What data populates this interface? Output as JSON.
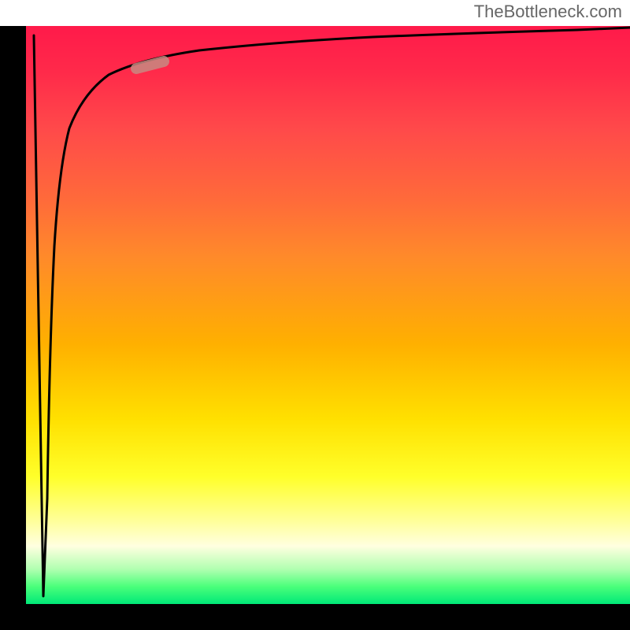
{
  "attribution": "TheBottleneck.com",
  "chart_data": {
    "type": "line",
    "title": "",
    "xlabel": "",
    "ylabel": "",
    "xlim": [
      0,
      100
    ],
    "ylim": [
      0,
      100
    ],
    "note": "Axes are unlabeled black bars; values normalized 0-100 on each axis. Background is a vertical red→orange→yellow→green gradient (red = high bottleneck, green = low). Curve is a single black line with a sharp initial spike from top to bottom and an asymptotic rise to the right. A salmon-colored pill marker highlights a point on the rising curve.",
    "series": [
      {
        "name": "bottleneck-curve",
        "x": [
          1.3,
          2.9,
          3.5,
          4.7,
          5.5,
          7.2,
          9.4,
          13.7,
          18.9,
          28.7,
          41.7,
          57.4,
          73.0,
          91.3,
          100.0
        ],
        "y": [
          98.4,
          1.4,
          18.3,
          61.9,
          75.5,
          82.3,
          88.3,
          91.6,
          94.3,
          95.8,
          97.3,
          98.1,
          98.8,
          99.3,
          99.7
        ]
      }
    ],
    "marker": {
      "x_range": [
        18.3,
        22.8
      ],
      "y_range": [
        92.6,
        93.9
      ]
    },
    "background_gradient_stops": [
      {
        "pos": 0.0,
        "color": "#ff1a4a"
      },
      {
        "pos": 0.18,
        "color": "#ff4a4a"
      },
      {
        "pos": 0.4,
        "color": "#ff8a2a"
      },
      {
        "pos": 0.68,
        "color": "#ffe000"
      },
      {
        "pos": 0.86,
        "color": "#ffffa0"
      },
      {
        "pos": 0.94,
        "color": "#b0ffb0"
      },
      {
        "pos": 1.0,
        "color": "#00e878"
      }
    ]
  },
  "colors": {
    "axis": "#000000",
    "curve": "#000000",
    "marker": "#c78a82",
    "attribution_text": "#666666"
  }
}
